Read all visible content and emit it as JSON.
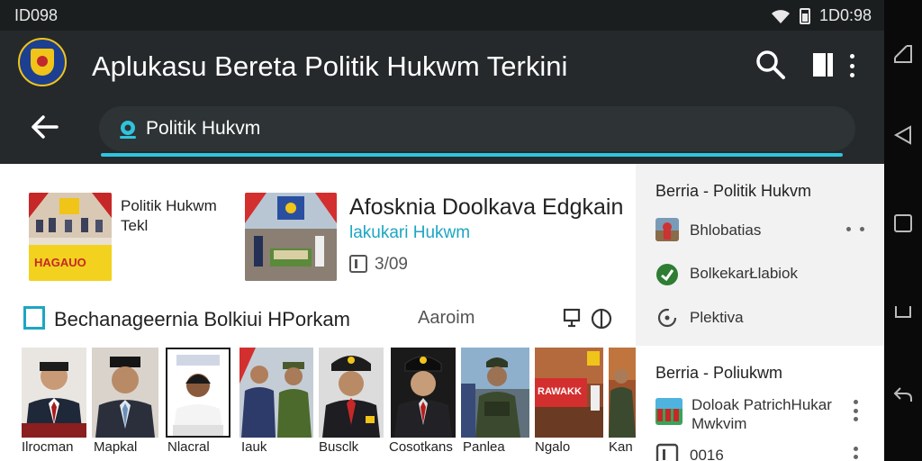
{
  "status_bar": {
    "left_text": "ID098",
    "time": "1D0:98"
  },
  "app_bar": {
    "title": "Aplukasu Bereta Politik Hukwm Terkini",
    "search_text": "Politik Hukvm"
  },
  "news": [
    {
      "title": "Politik Hukwm Tekl",
      "thumb_text": "HAGAUO"
    },
    {
      "title": "Afosknia Doolkava Edgkain",
      "subtitle": "lakukari Hukwm",
      "date": "3/09"
    }
  ],
  "section": {
    "title": "Bechanageernia Bolkiui HPorkam",
    "extra": "Aaroim"
  },
  "people": [
    {
      "name": "Ilrocman"
    },
    {
      "name": "Mapkal"
    },
    {
      "name": "Nlacral"
    },
    {
      "name": "Iauk"
    },
    {
      "name": "Busclk"
    },
    {
      "name": "Cosotkans"
    },
    {
      "name": "Panlea"
    },
    {
      "name": "Ngalo",
      "thumb_text": "RAWAKK"
    },
    {
      "name": "Kan"
    }
  ],
  "side_panel": {
    "card1": {
      "title": "Berria - Politik Hukvm",
      "items": [
        {
          "label": "Bhlobatias"
        },
        {
          "label": "BolkekarŁlabiok"
        },
        {
          "label": "Plektiva"
        }
      ]
    },
    "card2": {
      "title": "Berria - Poliukwm",
      "item_title_1": "Doloak PatrichHukar",
      "item_title_2": "Mwkvim",
      "item_date": "0016"
    }
  },
  "colors": {
    "accent": "#1ca6c2",
    "appbar": "#25292b",
    "statusbar": "#1b1e1f"
  }
}
